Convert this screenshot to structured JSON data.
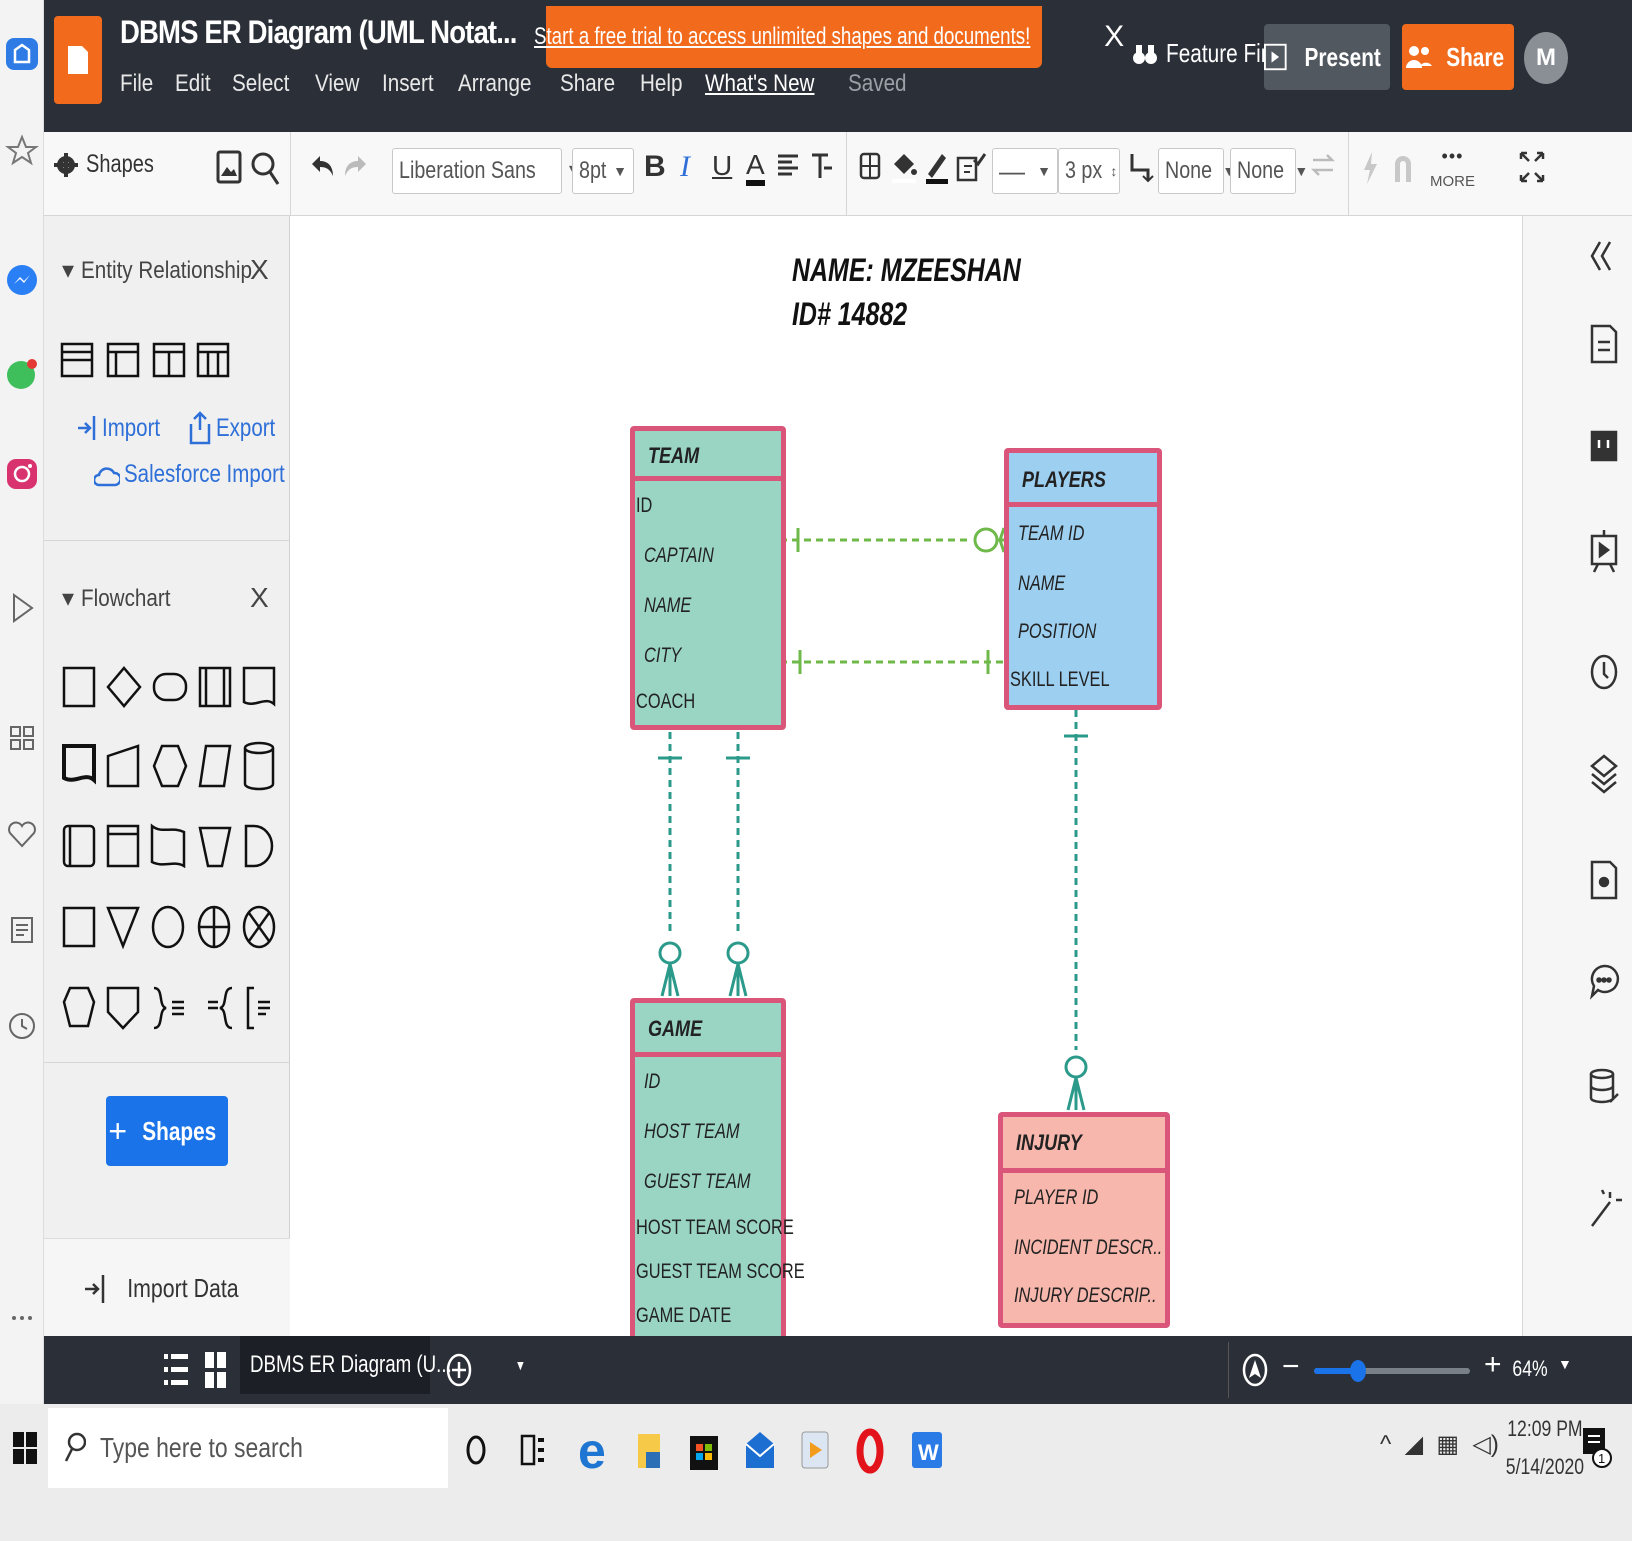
{
  "app": {
    "doc_title": "DBMS ER Diagram (UML Notat...",
    "menu": [
      "File",
      "Edit",
      "Select",
      "View",
      "Insert",
      "Arrange",
      "Share",
      "Help"
    ],
    "whats_new": "What's New",
    "saved": "Saved",
    "trial_banner": "Start a free trial to access unlimited shapes and documents!",
    "trial_close": "X",
    "feature_find": "Feature Find",
    "present": "Present",
    "share": "Share",
    "avatar": "M"
  },
  "toolbar": {
    "shapes_label": "Shapes",
    "font": "Liberation Sans",
    "font_size": "8pt",
    "bold": "B",
    "italic": "I",
    "underline": "U",
    "font_color": "A",
    "line_width": "3 px",
    "line_start": "None",
    "line_end": "None",
    "more": "MORE"
  },
  "left_panel": {
    "er_section": "Entity Relationship",
    "import": "Import",
    "export": "Export",
    "salesforce_import": "Salesforce Import",
    "flowchart_section": "Flowchart",
    "close": "X",
    "shapes_button": "Shapes",
    "import_data": "Import Data"
  },
  "diagram": {
    "author_name": "NAME: MZEESHAN",
    "author_id": "ID# 14882",
    "entities": {
      "team": {
        "title": "TEAM",
        "fields": [
          "ID",
          "CAPTAIN",
          "NAME",
          "CITY",
          "COACH"
        ]
      },
      "players": {
        "title": "PLAYERS",
        "fields": [
          "TEAM ID",
          "NAME",
          "POSITION",
          "SKILL LEVEL"
        ]
      },
      "game": {
        "title": "GAME",
        "fields": [
          "ID",
          "HOST TEAM",
          "GUEST TEAM",
          "HOST TEAM SCORE",
          "GUEST TEAM SCORE",
          "GAME DATE"
        ]
      },
      "injury": {
        "title": "INJURY",
        "fields": [
          "PLAYER ID",
          "INCIDENT DESCR..",
          "INJURY DESCRIP.."
        ]
      }
    },
    "colors": {
      "teal": "#9ad5c4",
      "blue": "#9dcff0",
      "salmon": "#f7b7ac",
      "border": "#d9567a",
      "connector": "#6fb84a",
      "connector_teal": "#2b9a8a"
    }
  },
  "bottom_bar": {
    "page_tab": "DBMS ER Diagram (U...",
    "zoom": "64%"
  },
  "taskbar": {
    "search_placeholder": "Type here to search",
    "time": "12:09 PM",
    "date": "5/14/2020"
  }
}
